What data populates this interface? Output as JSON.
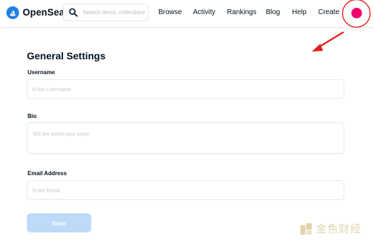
{
  "header": {
    "brand": "OpenSea",
    "search_placeholder": "Search items, collections, and accounts",
    "nav": {
      "browse": "Browse",
      "activity": "Activity",
      "rankings": "Rankings",
      "blog": "Blog",
      "help": "Help",
      "create": "Create"
    },
    "avatar_color": "#f2006f",
    "icons": [
      "opensea-logo-icon",
      "search-icon"
    ]
  },
  "form": {
    "title": "General Settings",
    "username": {
      "label": "Username",
      "placeholder": "Enter Username",
      "value": ""
    },
    "bio": {
      "label": "Bio",
      "placeholder": "Tell the world your story!",
      "value": ""
    },
    "email": {
      "label": "Email Address",
      "placeholder": "Enter Email",
      "value": ""
    },
    "save_label": "Save",
    "save_button_color": "#bfdaf9"
  },
  "annotation": {
    "color": "#e0201a",
    "shapes": [
      "circle-highlight",
      "arrow"
    ]
  },
  "watermark": {
    "text": "金色财经",
    "color": "#c9b06a"
  }
}
